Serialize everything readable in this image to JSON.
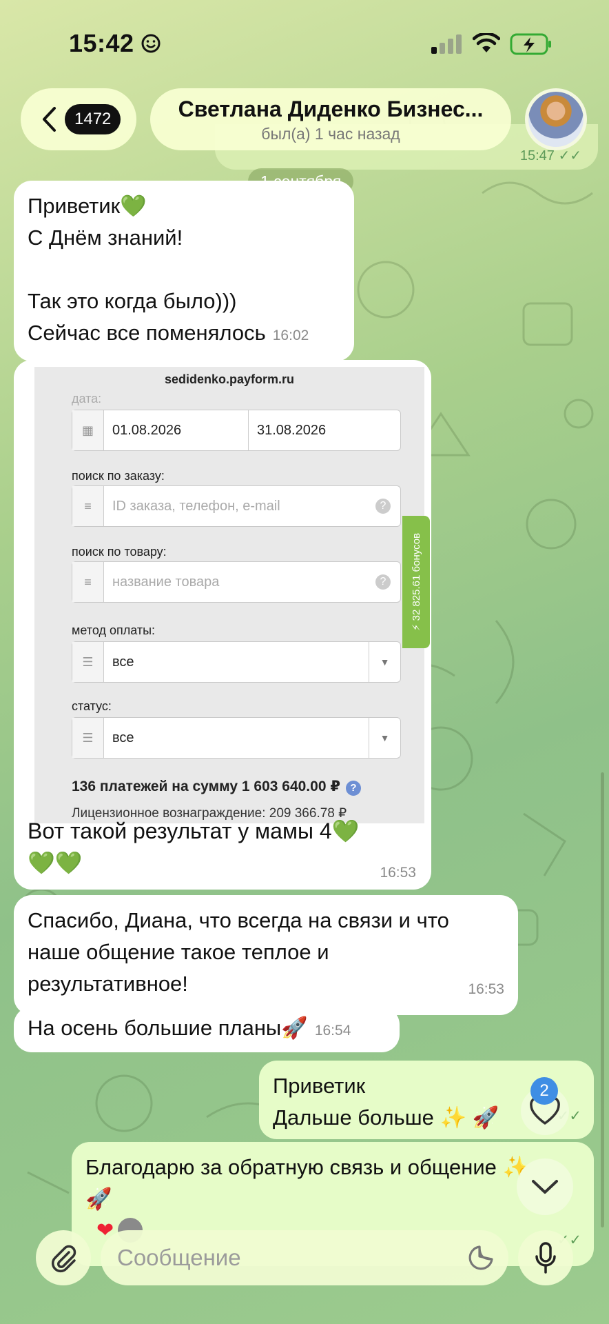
{
  "status_bar": {
    "time": "15:42"
  },
  "header": {
    "back_count": "1472",
    "title": "Светлана Диденко Бизнес...",
    "subtitle": "был(а) 1 час назад"
  },
  "ghost_message": {
    "time": "15:47"
  },
  "date_chip": "1 сентября",
  "messages": [
    {
      "line1": "Приветик",
      "line2": "С Днём знаний!",
      "line3": "Так это когда было)))",
      "line4": "Сейчас все поменялось",
      "time": "16:02"
    },
    {
      "text": "Вот такой результат у мамы 4",
      "time": "16:53"
    },
    {
      "line1": "Спасибо, Диана, что всегда на связи и что",
      "line2": "наше общение такое теплое и",
      "line3": "результативное!",
      "time": "16:53"
    },
    {
      "text": "На осень большие планы",
      "rocket": "🚀",
      "time": "16:54"
    },
    {
      "line1": "Приветик",
      "line2": "Дальше больше",
      "sparkles": "✨",
      "rocket": "🚀"
    },
    {
      "line1": "Благодарю за обратную связь и общение",
      "sparkles": "✨",
      "rocket": "🚀"
    }
  ],
  "screenshot": {
    "domain": "sedidenko.payform.ru",
    "date_label": "дата:",
    "date_from": "01.08.2026",
    "date_to": "31.08.2026",
    "order_search_label": "поиск по заказу:",
    "order_search_placeholder": "ID заказа, телефон, e-mail",
    "product_search_label": "поиск по товару:",
    "product_search_placeholder": "название товара",
    "payment_method_label": "метод оплаты:",
    "payment_method_value": "все",
    "status_label": "статус:",
    "status_value": "все",
    "summary": "136 платежей на сумму 1 603 640.00 ₽",
    "license": "Лицензионное вознаграждение: 209 366.78 ₽",
    "bonus_tab": "⚡ 32 825.61 бонусов"
  },
  "reaction_badge": "2",
  "composer": {
    "placeholder": "Сообщение"
  },
  "colors": {
    "accent_green": "#4fc13a",
    "badge_blue": "#3f8ee4",
    "outgoing_bubble": "#e6fcc8"
  }
}
